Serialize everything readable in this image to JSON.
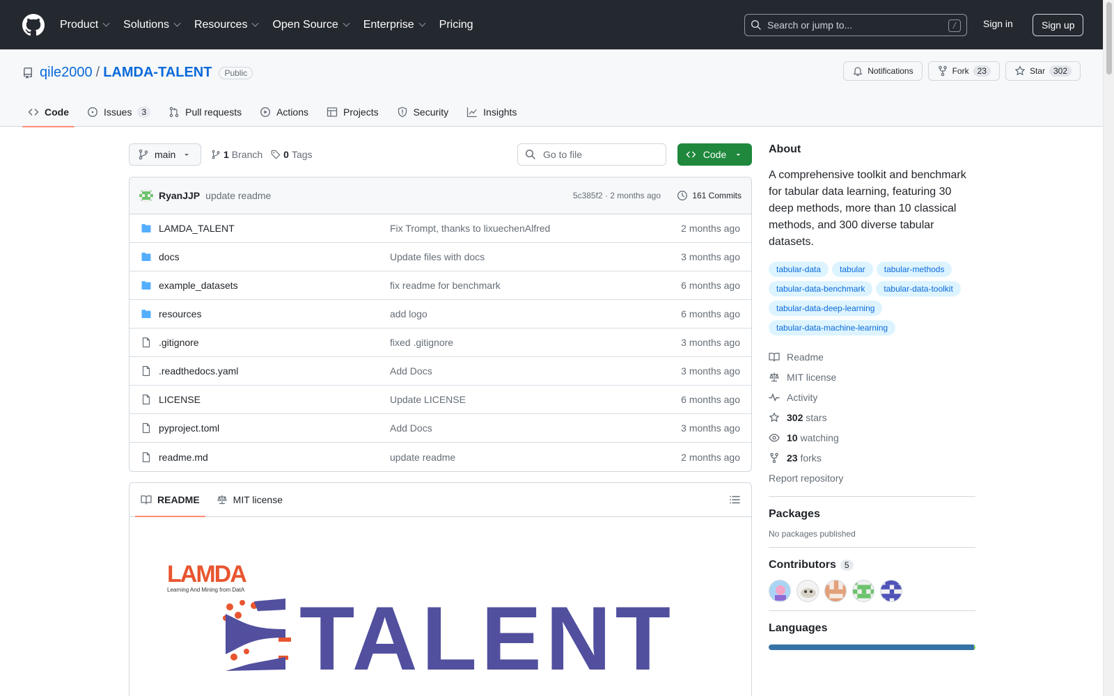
{
  "header": {
    "nav": [
      "Product",
      "Solutions",
      "Resources",
      "Open Source",
      "Enterprise",
      "Pricing"
    ],
    "search_placeholder": "Search or jump to...",
    "search_shortcut": "/",
    "sign_in": "Sign in",
    "sign_up": "Sign up"
  },
  "repo": {
    "owner": "qile2000",
    "separator": "/",
    "name": "LAMDA-TALENT",
    "visibility": "Public",
    "notifications_label": "Notifications",
    "fork_label": "Fork",
    "fork_count": "23",
    "star_label": "Star",
    "star_count": "302",
    "tabs": [
      {
        "label": "Code",
        "icon": "code-icon",
        "active": true
      },
      {
        "label": "Issues",
        "icon": "issue-icon",
        "count": "3"
      },
      {
        "label": "Pull requests",
        "icon": "pull-request-icon"
      },
      {
        "label": "Actions",
        "icon": "play-icon"
      },
      {
        "label": "Projects",
        "icon": "table-icon"
      },
      {
        "label": "Security",
        "icon": "shield-icon"
      },
      {
        "label": "Insights",
        "icon": "graph-icon"
      }
    ]
  },
  "toolbar": {
    "branch": "main",
    "branch_count": "1",
    "branch_label": "Branch",
    "tag_count": "0",
    "tag_label": "Tags",
    "goto_placeholder": "Go to file",
    "code_button": "Code"
  },
  "latest_commit": {
    "author": "RyanJJP",
    "message": "update readme",
    "hash_time": "5c385f2 · 2 months ago",
    "commits": "161 Commits"
  },
  "files": [
    {
      "type": "folder",
      "name": "LAMDA_TALENT",
      "message": "Fix Trompt, thanks to lixuechenAlfred",
      "date": "2 months ago"
    },
    {
      "type": "folder",
      "name": "docs",
      "message": "Update files with docs",
      "date": "3 months ago"
    },
    {
      "type": "folder",
      "name": "example_datasets",
      "message": "fix readme for benchmark",
      "date": "6 months ago"
    },
    {
      "type": "folder",
      "name": "resources",
      "message": "add logo",
      "date": "6 months ago"
    },
    {
      "type": "file",
      "name": ".gitignore",
      "message": "fixed .gitignore",
      "date": "3 months ago"
    },
    {
      "type": "file",
      "name": ".readthedocs.yaml",
      "message": "Add Docs",
      "date": "3 months ago"
    },
    {
      "type": "file",
      "name": "LICENSE",
      "message": "Update LICENSE",
      "date": "6 months ago"
    },
    {
      "type": "file",
      "name": "pyproject.toml",
      "message": "Add Docs",
      "date": "3 months ago"
    },
    {
      "type": "file",
      "name": "readme.md",
      "message": "update readme",
      "date": "2 months ago"
    }
  ],
  "readme": {
    "tab_readme": "README",
    "tab_license": "MIT license",
    "logo_text_lamda": "LAMDA",
    "logo_subtitle": "Learning And Mining from DatA",
    "logo_title": "TALENT"
  },
  "about": {
    "heading": "About",
    "description": "A comprehensive toolkit and benchmark for tabular data learning, featuring 30 deep methods, more than 10 classical methods, and 300 diverse tabular datasets.",
    "topics": [
      "tabular-data",
      "tabular",
      "tabular-methods",
      "tabular-data-benchmark",
      "tabular-data-toolkit",
      "tabular-data-deep-learning",
      "tabular-data-machine-learning"
    ],
    "readme": "Readme",
    "license": "MIT license",
    "activity": "Activity",
    "stars_count": "302",
    "stars_label": "stars",
    "watching_count": "10",
    "watching_label": "watching",
    "forks_count": "23",
    "forks_label": "forks",
    "report": "Report repository"
  },
  "packages": {
    "heading": "Packages",
    "empty": "No packages published"
  },
  "contributors": {
    "heading": "Contributors",
    "count": "5"
  },
  "languages": {
    "heading": "Languages"
  },
  "colors": {
    "header_bg": "#24292f",
    "link": "#0969da",
    "green": "#1f883d",
    "tab_underline": "#fd8c73",
    "python": "#3572A5",
    "shell": "#89e051"
  }
}
